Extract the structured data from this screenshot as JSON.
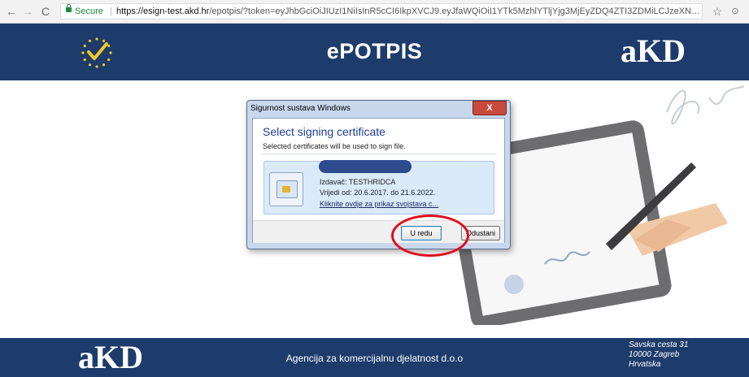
{
  "browser": {
    "back_icon": "←",
    "forward_icon": "→",
    "reload_icon": "C",
    "secure_label": "Secure",
    "url_host": "https://esign-test.akd.hr",
    "url_rest": "/epotpis/?token=eyJhbGciOiJIUzI1NiIsInR5cCI6IkpXVCJ9.eyJfaWQiOiI1YTk5MzhlYTljYjg3MjEyZDQ4ZTI3ZDMiLCJzeXN0ZW0iOnsibmFtZSI...",
    "star_icon": "☆",
    "extension_icon": "⊙"
  },
  "header": {
    "title": "ePOTPIS",
    "logo_text": "aKD"
  },
  "dialog": {
    "window_title": "Sigurnost sustava Windows",
    "close_label": "X",
    "heading": "Select signing certificate",
    "subtext": "Selected certificates will be used to sign file.",
    "certificate": {
      "issuer": "Izdavač: TESTHRIDCA",
      "validity": "Vrijedi od: 20.6.2017. do 21.6.2022.",
      "details_link": "Kliknite ovdje za prikaz svojstava c..."
    },
    "ok_label": "U redu",
    "cancel_label": "Odustani"
  },
  "footer": {
    "logo_text": "aKD",
    "company": "Agencija za komercijalnu djelatnost d.o.o",
    "address_line1": "Savska cesta 31",
    "address_line2": "10000 Zagreb",
    "address_line3": "Hrvatska"
  },
  "colors": {
    "header_bg": "#1d3c6b",
    "highlight": "#e0101e",
    "dialog_heading": "#1e3d8f"
  }
}
